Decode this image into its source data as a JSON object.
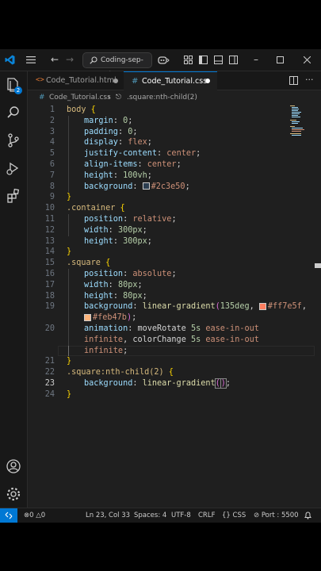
{
  "search": {
    "label": "Coding-sep-oct"
  },
  "tabs": [
    {
      "label": "Code_Tutorial.html",
      "icon": "html-icon"
    },
    {
      "label": "Code_Tutorial.css",
      "icon": "css-icon"
    }
  ],
  "breadcrumb": {
    "file": "Code_Tutorial.css",
    "symbol": ".square:nth-child(2)"
  },
  "activity": {
    "badge": "2"
  },
  "code_lines": [
    {
      "n": "1"
    },
    {
      "n": "2"
    },
    {
      "n": "3"
    },
    {
      "n": "4"
    },
    {
      "n": "5"
    },
    {
      "n": "6"
    },
    {
      "n": "7"
    },
    {
      "n": "8"
    },
    {
      "n": "9"
    },
    {
      "n": "10"
    },
    {
      "n": "11"
    },
    {
      "n": "12"
    },
    {
      "n": "13"
    },
    {
      "n": "14"
    },
    {
      "n": "15"
    },
    {
      "n": "16"
    },
    {
      "n": "17"
    },
    {
      "n": "18"
    },
    {
      "n": "19"
    },
    {
      "n": "20"
    },
    {
      "n": "21"
    },
    {
      "n": "22"
    },
    {
      "n": "23"
    },
    {
      "n": "24"
    }
  ],
  "code": {
    "l1": [
      "body",
      " {"
    ],
    "l2": [
      "margin",
      ": ",
      "0",
      ";"
    ],
    "l3": [
      "padding",
      ": ",
      "0",
      ";"
    ],
    "l4": [
      "display",
      ": ",
      "flex",
      ";"
    ],
    "l5": [
      "justify-content",
      ": ",
      "center",
      ";"
    ],
    "l6": [
      "align-items",
      ": ",
      "center",
      ";"
    ],
    "l7": [
      "height",
      ": ",
      "100vh",
      ";"
    ],
    "l8": [
      "background",
      ": ",
      "#2c3e50",
      ";"
    ],
    "l9": [
      "}"
    ],
    "l10": [
      ".container",
      " {"
    ],
    "l11": [
      "position",
      ": ",
      "relative",
      ";"
    ],
    "l12": [
      "width",
      ": ",
      "300px",
      ";"
    ],
    "l13": [
      "height",
      ": ",
      "300px",
      ";"
    ],
    "l14": [
      "}"
    ],
    "l15": [
      ".square",
      " {"
    ],
    "l16": [
      "position",
      ": ",
      "absolute",
      ";"
    ],
    "l17": [
      "width",
      ": ",
      "80px",
      ";"
    ],
    "l18": [
      "height",
      ": ",
      "80px",
      ";"
    ],
    "l19": [
      "background",
      ": ",
      "linear-gradient",
      "(",
      "135deg",
      ", ",
      "#ff7e5f",
      ","
    ],
    "l19b": [
      "#feb47b",
      ")",
      ";"
    ],
    "l20": [
      "animation",
      ": ",
      "moveRotate",
      " ",
      "5s",
      " ",
      "ease-in-out"
    ],
    "l20b": [
      "infinite",
      ", ",
      "colorChange",
      " ",
      "5s",
      " ",
      "ease-in-out"
    ],
    "l20c": [
      "infinite",
      ";"
    ],
    "l21": [
      "}"
    ],
    "l22": [
      ".square:nth-child(2)",
      " {"
    ],
    "l23": [
      "background",
      ": ",
      "linear-gradient",
      "(",
      ")",
      ";"
    ],
    "l24": [
      "}"
    ]
  },
  "colors": {
    "swatch1": "#2c3e50",
    "swatch2": "#ff7e5f",
    "swatch3": "#feb47b",
    "accent": "#0078d4"
  },
  "status": {
    "errors": "0",
    "warnings": "0",
    "position": "Ln 23, Col 33",
    "spaces": "Spaces: 4",
    "encoding": "UTF-8",
    "eol": "CRLF",
    "language": "CSS",
    "port": "Port : 5500"
  }
}
